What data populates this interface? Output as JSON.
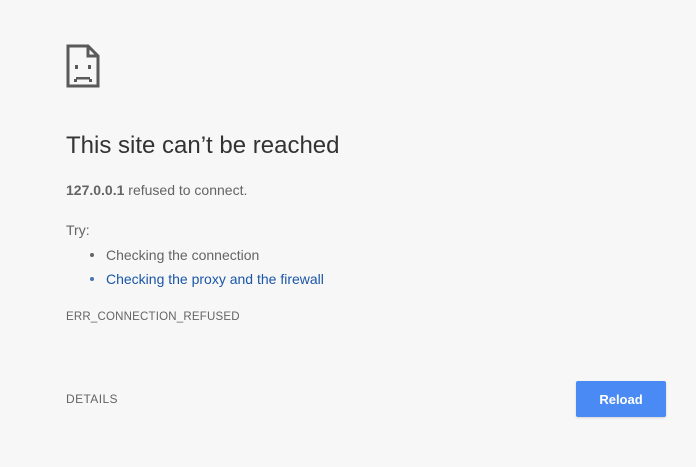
{
  "error_page": {
    "icon": "sad-page-icon",
    "title": "This site can’t be reached",
    "host": "127.0.0.1",
    "message": " refused to connect.",
    "try_label": "Try:",
    "suggestions": [
      {
        "label": "Checking the connection",
        "is_link": false
      },
      {
        "label": "Checking the proxy and the firewall",
        "is_link": true
      }
    ],
    "error_code": "ERR_CONNECTION_REFUSED",
    "details_label": "DETAILS",
    "reload_label": "Reload"
  },
  "colors": {
    "background": "#f7f7f7",
    "title_text": "#333333",
    "body_text": "#646464",
    "link": "#1a56a8",
    "reload_button": "#4a8af4"
  }
}
